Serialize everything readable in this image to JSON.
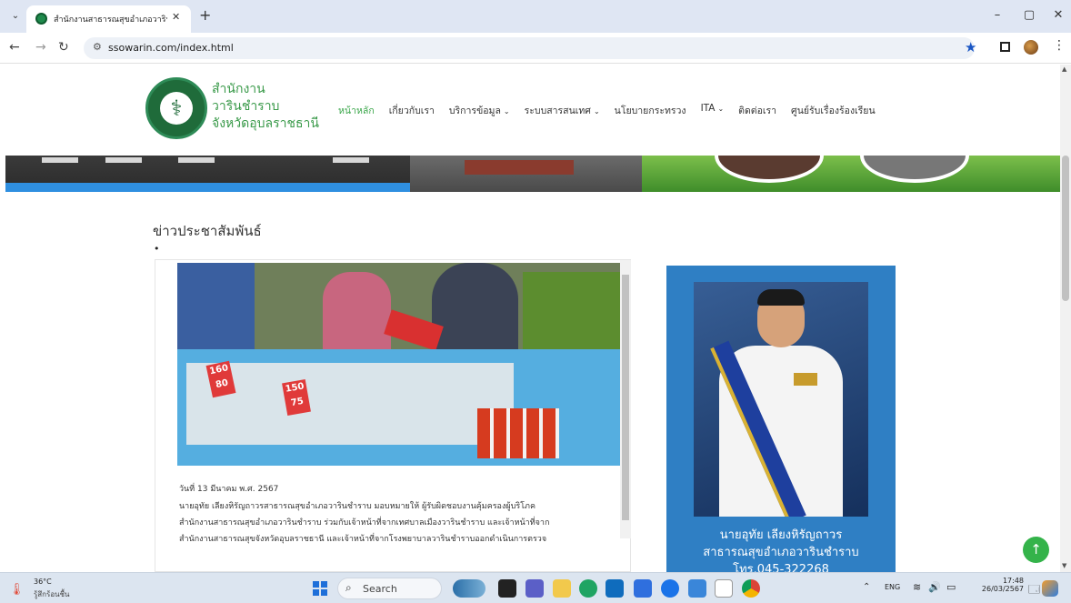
{
  "browser": {
    "tab_title": "สำนักงานสาธารณสุขอำเภอวารินชำราบ",
    "tab_close": "✕",
    "new_tab": "+",
    "url": "ssowarin.com/index.html",
    "window": {
      "minimize": "–",
      "restore": "▢",
      "close": "✕"
    }
  },
  "site": {
    "name_lines": [
      "สำนักงาน",
      "วารินชำราบ",
      "จังหวัดอุบลราชธานี"
    ],
    "nav": [
      {
        "label": "หน้าหลัก",
        "active": true,
        "dropdown": false
      },
      {
        "label": "เกี่ยวกับเรา",
        "active": false,
        "dropdown": false
      },
      {
        "label": "บริการข้อมูล",
        "active": false,
        "dropdown": true
      },
      {
        "label": "ระบบสารสนเทศ",
        "active": false,
        "dropdown": true
      },
      {
        "label": "นโยบายกระทรวง",
        "active": false,
        "dropdown": false
      },
      {
        "label": "ITA",
        "active": false,
        "dropdown": true
      },
      {
        "label": "ติดต่อเรา",
        "active": false,
        "dropdown": false
      },
      {
        "label": "ศูนย์รับเรื่องร้องเรียน",
        "active": false,
        "dropdown": false
      }
    ],
    "accent": "#3aa64a"
  },
  "news": {
    "section_title": "ข่าวประชาสัมพันธ์",
    "bullet": "•",
    "photo_signs": [
      "160\n80",
      "150\n75"
    ],
    "date": "วันที่ 13 มีนาคม พ.ศ. 2567",
    "body_lines": [
      "นายอุทัย เลียงหิรัญถาวรสาธารณสุขอำเภอวารินชำราบ มอบหมายให้ ผู้รับผิดชอบงานคุ้มครองผู้บริโภค",
      "สำนักงานสาธารณสุขอำเภอวารินชำราบ ร่วมกับเจ้าหน้าที่จากเทศบาลเมืองวารินชำราบ และเจ้าหน้าที่จาก",
      "สำนักงานสาธารณสุขจังหวัดอุบลราชธานี และเจ้าหน้าที่จากโรงพยาบาลวารินชำราบออกดำเนินการตรวจ"
    ]
  },
  "director": {
    "name_lines": [
      "นายอุทัย เลียงหิรัญถาวร",
      "สาธารณสุขอำเภอวารินชำราบ",
      "โทร.045-322268"
    ]
  },
  "taskbar": {
    "temp": "36°C",
    "weather_desc": "รู้สึกร้อนชื้น",
    "search_placeholder": "Search",
    "lang": "ENG",
    "time": "17:48",
    "date": "26/03/2567"
  }
}
